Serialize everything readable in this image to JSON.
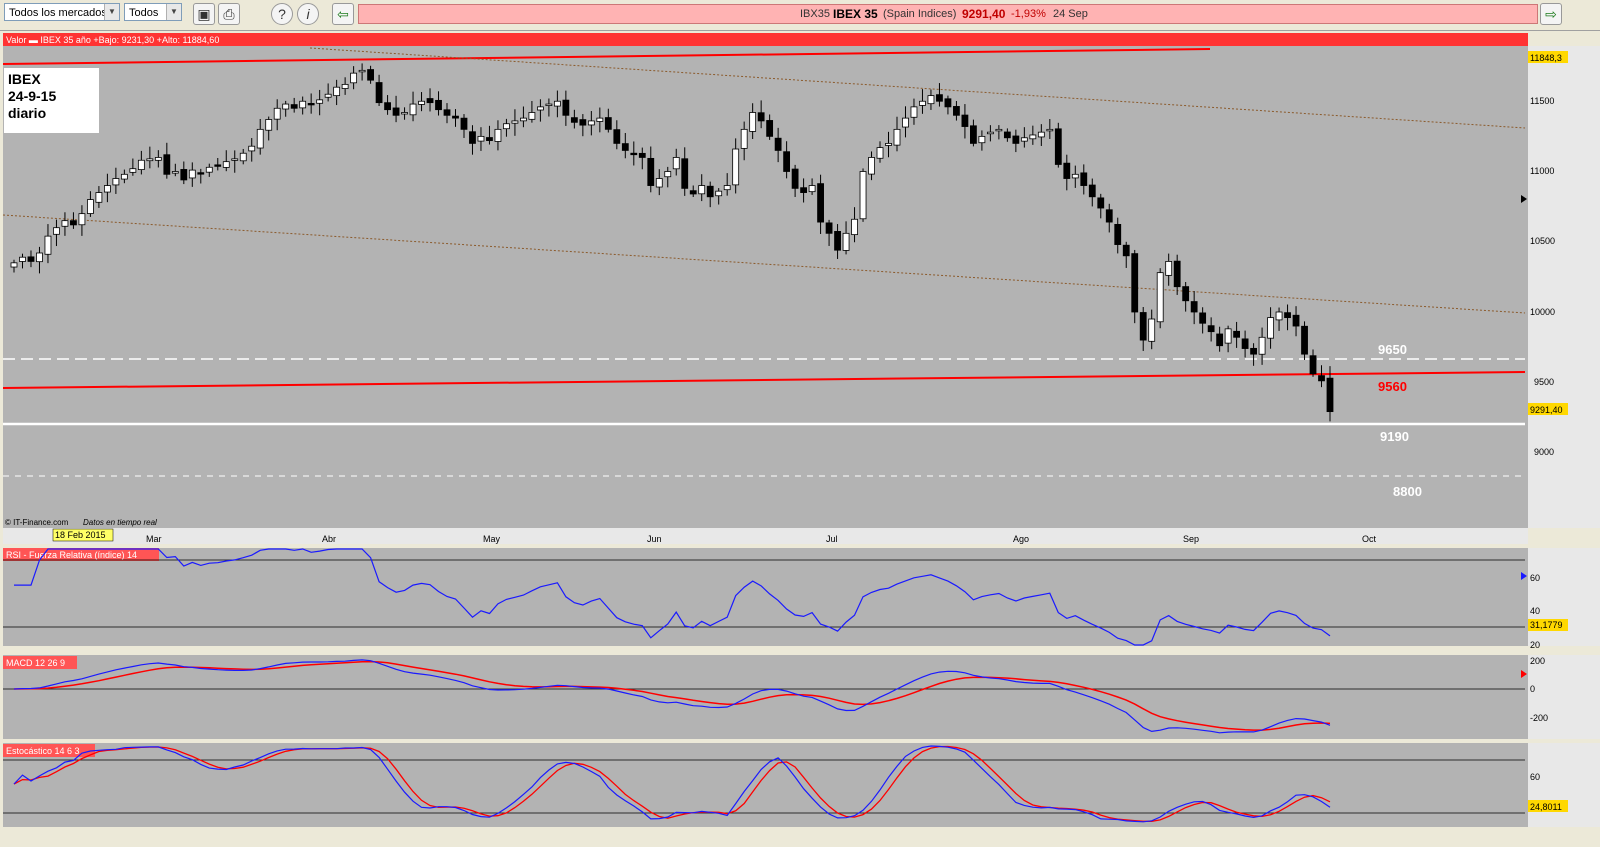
{
  "toolbar": {
    "market_select": "Todos los mercados",
    "type_select": "Todos",
    "ticker_code": "IBX35",
    "ticker_name": "IBEX 35",
    "ticker_desc": "(Spain Indices)",
    "ticker_price": "9291,40",
    "ticker_change": "-1,93%",
    "ticker_date": "24 Sep"
  },
  "colors": {
    "pane_bg": "#b3b3b3",
    "header_red": "#ff3333",
    "rsi_blue": "#1a1aff",
    "signal_red": "#ff0000",
    "price_tag": "#ffd800"
  },
  "main_chart": {
    "header": "Valor  ▬ IBEX 35   año +Bajo: 9231,30 +Alto: 11884,60",
    "annotation": [
      "IBEX",
      "24-9-15",
      "diario"
    ],
    "watermark": "© IT-Finance.com",
    "realtime": "Datos en tiempo real",
    "date_tag": "18 Feb 2015",
    "level_labels": [
      "9650",
      "9560",
      "9190",
      "8800"
    ],
    "y_ticks": [
      "11500",
      "11000",
      "10500",
      "10000",
      "9500",
      "9000"
    ],
    "top_tag": "11848,3",
    "price_tag": "9291,40",
    "months": [
      "Mar",
      "Abr",
      "May",
      "Jun",
      "Jul",
      "Ago",
      "Sep",
      "Oct"
    ]
  },
  "rsi": {
    "title": "RSI - Fuerza Relativa (índice) 14",
    "ticks": [
      "60",
      "40",
      "20"
    ],
    "value_tag": "31,1779"
  },
  "macd": {
    "title": "MACD 12 26 9",
    "ticks": [
      "200",
      "0",
      "-200"
    ]
  },
  "stoch": {
    "title": "Estocástico 14 6 3",
    "ticks": [
      "60"
    ],
    "value_tag": "24,8011"
  },
  "chart_data": {
    "type": "candlestick",
    "close": [
      10350,
      10390,
      10360,
      10420,
      10540,
      10600,
      10650,
      10620,
      10700,
      10800,
      10850,
      10900,
      10950,
      10980,
      11020,
      11080,
      11090,
      11100,
      10980,
      11000,
      10940,
      11010,
      10990,
      11030,
      11040,
      11070,
      11090,
      11130,
      11180,
      11300,
      11370,
      11450,
      11480,
      11450,
      11500,
      11480,
      11510,
      11550,
      11600,
      11620,
      11700,
      11720,
      11650,
      11490,
      11440,
      11400,
      11420,
      11480,
      11500,
      11490,
      11440,
      11400,
      11380,
      11300,
      11200,
      11250,
      11220,
      11300,
      11340,
      11360,
      11380,
      11420,
      11460,
      11480,
      11500,
      11400,
      11350,
      11330,
      11360,
      11380,
      11300,
      11200,
      11150,
      11120,
      11100,
      10900,
      10950,
      11000,
      11100,
      10880,
      10840,
      10900,
      10820,
      10860,
      10900,
      11160,
      11300,
      11420,
      11360,
      11250,
      11150,
      11000,
      10880,
      10850,
      10900,
      10640,
      10560,
      10440,
      10560,
      10660,
      11000,
      11100,
      11170,
      11200,
      11300,
      11380,
      11460,
      11500,
      11540,
      11500,
      11460,
      11400,
      11320,
      11200,
      11250,
      11280,
      11300,
      11240,
      11200,
      11240,
      11260,
      11280,
      11300,
      11050,
      10950,
      10980,
      10900,
      10820,
      10740,
      10640,
      10480,
      10400,
      10000,
      9800,
      9950,
      10280,
      10360,
      10180,
      10080,
      10000,
      9920,
      9860,
      9760,
      9880,
      9820,
      9740,
      9700,
      9820,
      9960,
      10000,
      9960,
      9900,
      9700,
      9560,
      9510,
      9291
    ],
    "x_tick_labels": [
      "Mar",
      "Abr",
      "May",
      "Jun",
      "Jul",
      "Ago",
      "Sep",
      "Oct"
    ],
    "y_tick_labels": [
      "11500",
      "11000",
      "10500",
      "10000",
      "9500",
      "9000"
    ],
    "ylim": [
      8600,
      11950
    ]
  }
}
